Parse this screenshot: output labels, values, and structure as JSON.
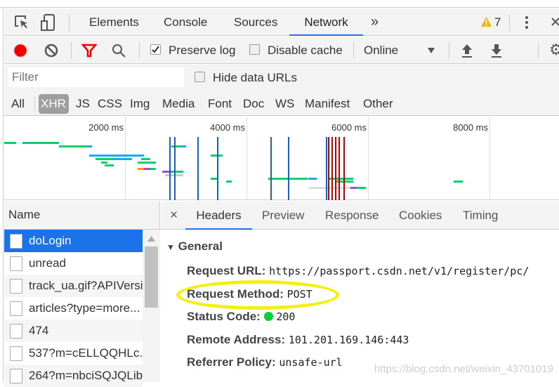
{
  "tabs": {
    "items": [
      "Elements",
      "Console",
      "Sources",
      "Network"
    ],
    "more": "»",
    "active": "Network",
    "warnings": "7"
  },
  "toolbar": {
    "preserve_log": "Preserve log",
    "preserve_log_checked": true,
    "disable_cache": "Disable cache",
    "disable_cache_checked": false,
    "throttle": "Online"
  },
  "filter": {
    "placeholder": "Filter",
    "hide_data_urls": "Hide data URLs"
  },
  "types": {
    "items": [
      "All",
      "XHR",
      "JS",
      "CSS",
      "Img",
      "Media",
      "Font",
      "Doc",
      "WS",
      "Manifest",
      "Other"
    ],
    "selected": "XHR"
  },
  "overview": {
    "ticks": [
      "2000 ms",
      "4000 ms",
      "6000 ms",
      "8000 ms"
    ],
    "bars": [
      {
        "lane": 0,
        "start": 0,
        "end": 200,
        "color": "#0cce6b"
      },
      {
        "lane": 0,
        "start": 300,
        "end": 900,
        "color": "#0cce6b"
      },
      {
        "lane": 1,
        "start": 900,
        "end": 1350,
        "color": "#0cce6b"
      },
      {
        "lane": 1,
        "start": 1350,
        "end": 1450,
        "color": "#1ba8f0"
      },
      {
        "lane": 1,
        "start": 2750,
        "end": 2900,
        "color": "#0cce6b"
      },
      {
        "lane": 1,
        "start": 2900,
        "end": 3000,
        "color": "#1ba8f0"
      },
      {
        "lane": 4,
        "start": 1400,
        "end": 1800,
        "color": "#1ba8f0"
      },
      {
        "lane": 4,
        "start": 1800,
        "end": 2300,
        "color": "#1ba8f0"
      },
      {
        "lane": 4,
        "start": 3400,
        "end": 3600,
        "color": "#0cce6b"
      },
      {
        "lane": 5,
        "start": 1500,
        "end": 1800,
        "color": "#0cce6b"
      },
      {
        "lane": 5,
        "start": 1800,
        "end": 2100,
        "color": "#1ba8f0"
      },
      {
        "lane": 5,
        "start": 2250,
        "end": 2400,
        "color": "#0cce6b"
      },
      {
        "lane": 6,
        "start": 1600,
        "end": 1700,
        "color": "#0cce6b"
      },
      {
        "lane": 6,
        "start": 2200,
        "end": 2500,
        "color": "#0cce6b"
      },
      {
        "lane": 7,
        "start": 1650,
        "end": 1800,
        "color": "#0cce6b"
      },
      {
        "lane": 8,
        "start": 2200,
        "end": 2300,
        "color": "#f29900"
      },
      {
        "lane": 8,
        "start": 2300,
        "end": 2400,
        "color": "#a142f4"
      },
      {
        "lane": 8,
        "start": 2400,
        "end": 2500,
        "color": "#0cce6b"
      },
      {
        "lane": 9,
        "start": 2600,
        "end": 2750,
        "color": "#a142f4"
      },
      {
        "lane": 9,
        "start": 2750,
        "end": 2950,
        "color": "#0cce6b"
      },
      {
        "lane": 10,
        "start": 2650,
        "end": 2950,
        "color": "#cccccc"
      },
      {
        "lane": 11,
        "start": 3400,
        "end": 3500,
        "color": "#0cce6b"
      },
      {
        "lane": 11,
        "start": 4350,
        "end": 5000,
        "color": "#0cce6b"
      },
      {
        "lane": 11,
        "start": 5000,
        "end": 5150,
        "color": "#1ba8f0"
      },
      {
        "lane": 11,
        "start": 5350,
        "end": 5750,
        "color": "#0cce6b"
      },
      {
        "lane": 12,
        "start": 3650,
        "end": 3750,
        "color": "#0cce6b"
      },
      {
        "lane": 12,
        "start": 5450,
        "end": 5750,
        "color": "#0cce6b"
      },
      {
        "lane": 12,
        "start": 7400,
        "end": 7550,
        "color": "#0cce6b"
      },
      {
        "lane": 14,
        "start": 5000,
        "end": 5700,
        "color": "#dddddd"
      },
      {
        "lane": 14,
        "start": 5700,
        "end": 5800,
        "color": "#a142f4"
      },
      {
        "lane": 14,
        "start": 5800,
        "end": 5950,
        "color": "#0cce6b"
      }
    ],
    "lines": [
      {
        "ms": 2720,
        "color": "#1a5fc9"
      },
      {
        "ms": 2800,
        "color": "#1a5fc9"
      },
      {
        "ms": 3180,
        "color": "#1a5fc9"
      },
      {
        "ms": 3500,
        "color": "#1a5fc9"
      },
      {
        "ms": 4380,
        "color": "#1a5fc9"
      },
      {
        "ms": 4670,
        "color": "#1a5fc9"
      },
      {
        "ms": 5290,
        "color": "#1a5fc9"
      },
      {
        "ms": 5330,
        "color": "#c00000"
      },
      {
        "ms": 5390,
        "color": "#c00000"
      },
      {
        "ms": 5450,
        "color": "#c00000"
      },
      {
        "ms": 5500,
        "color": "#c00000"
      },
      {
        "ms": 5580,
        "color": "#c00000"
      }
    ]
  },
  "requests": {
    "header": "Name",
    "items": [
      "doLogin",
      "unread",
      "track_ua.gif?APIVersi",
      "articles?type=more...",
      "474",
      "537?m=cELLQQHLc.",
      "264?m=nbciSQJQLib"
    ],
    "selected": "doLogin"
  },
  "details": {
    "close": "×",
    "tabs": [
      "Headers",
      "Preview",
      "Response",
      "Cookies",
      "Timing"
    ],
    "active": "Headers",
    "section": "General",
    "fields": [
      {
        "key": "Request URL:",
        "value": "https://passport.csdn.net/v1/register/pc/"
      },
      {
        "key": "Request Method:",
        "value": "POST"
      },
      {
        "key": "Status Code:",
        "value": "200",
        "status_color": "#0cce3b"
      },
      {
        "key": "Remote Address:",
        "value": "101.201.169.146:443"
      },
      {
        "key": "Referrer Policy:",
        "value": "unsafe-url"
      }
    ],
    "highlight_color": "#f5ef10"
  },
  "watermark": "https://blog.csdn.net/weixin_43701019"
}
